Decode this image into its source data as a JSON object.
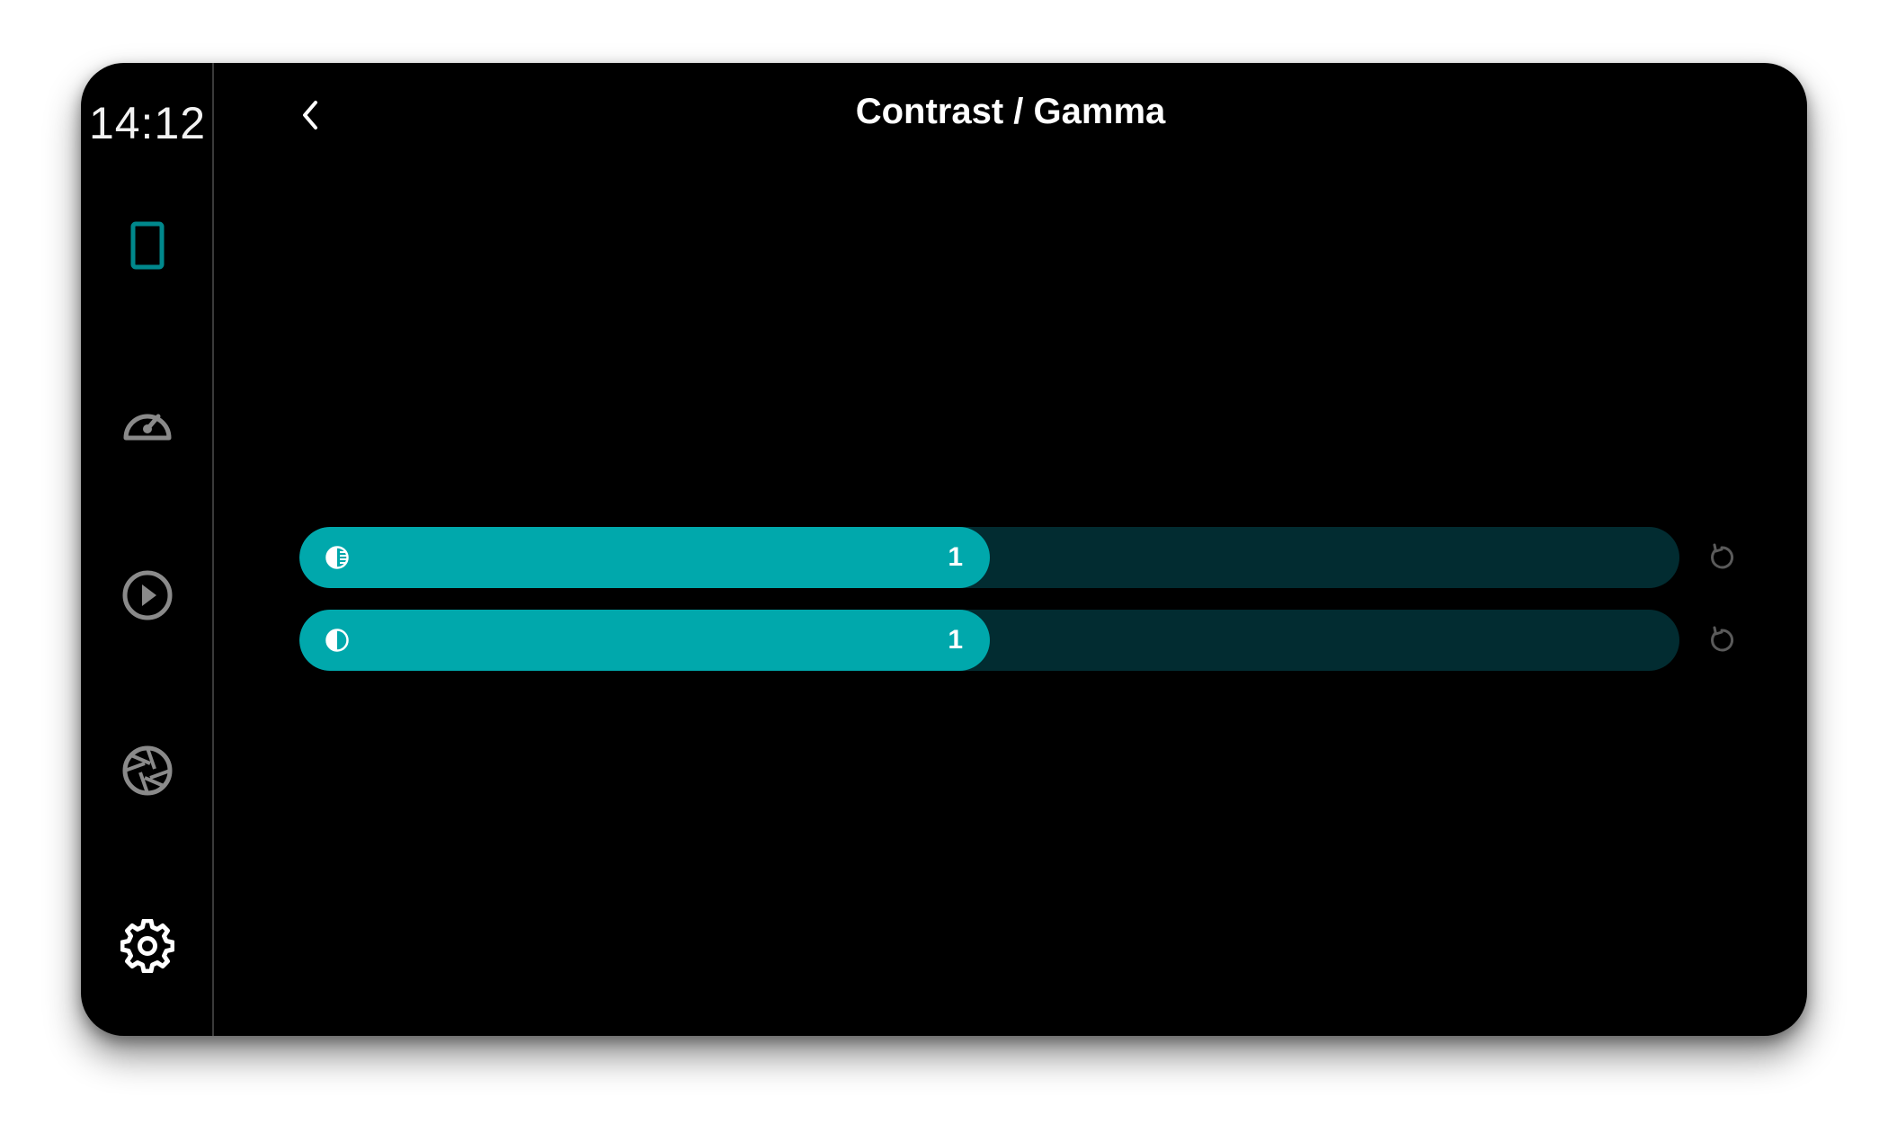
{
  "status": {
    "time": "14:12"
  },
  "colors": {
    "accent": "#00a8ac",
    "track": "#022c31",
    "icon_inactive": "#8a8a8a",
    "icon_active": "#00888c",
    "background": "#000000"
  },
  "sidebar": {
    "items": [
      {
        "name": "display",
        "icon": "tablet-icon",
        "active": true
      },
      {
        "name": "speedometer",
        "icon": "speedometer-icon",
        "active": false
      },
      {
        "name": "play",
        "icon": "play-circle-icon",
        "active": false
      },
      {
        "name": "camera",
        "icon": "aperture-icon",
        "active": false
      },
      {
        "name": "settings",
        "icon": "gear-icon",
        "active": false
      }
    ]
  },
  "header": {
    "back_icon": "chevron-left-icon",
    "title": "Contrast / Gamma"
  },
  "sliders": [
    {
      "name": "contrast",
      "icon": "contrast-icon",
      "value": "1",
      "fill_fraction": 0.5,
      "reset_icon": "reset-icon"
    },
    {
      "name": "gamma",
      "icon": "half-circle-icon",
      "value": "1",
      "fill_fraction": 0.5,
      "reset_icon": "reset-icon"
    }
  ]
}
